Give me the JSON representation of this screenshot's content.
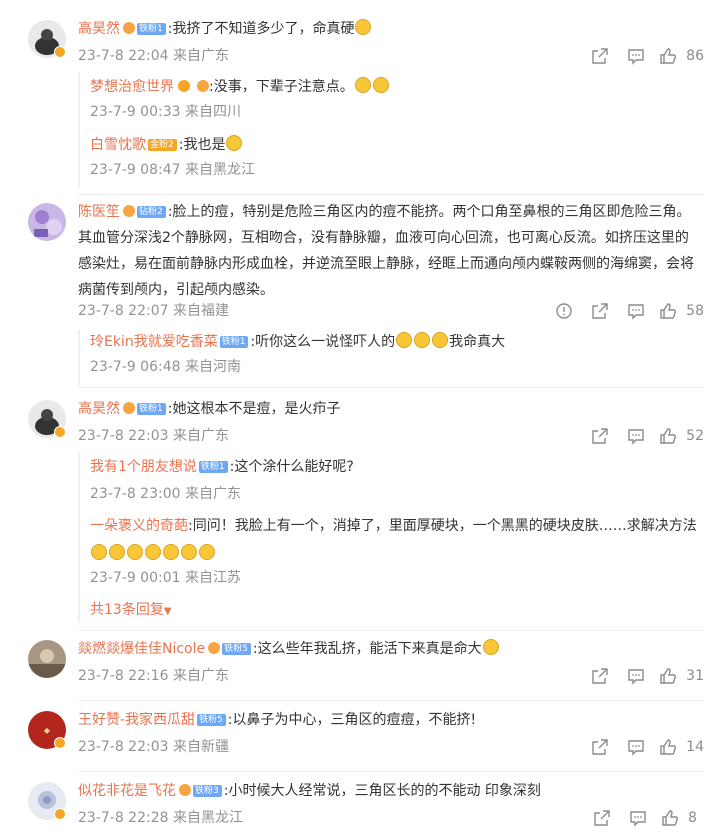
{
  "comments": [
    {
      "user": "高昊然",
      "fan_badge": "铁粉1",
      "text": ":我挤了不知道多少了，命真硬",
      "time": "23-7-8 22:04",
      "location": "来自广东",
      "likes": "86",
      "replies": [
        {
          "user": "梦想治愈世界",
          "text": ":没事，下辈子注意点。",
          "time": "23-7-9 00:33",
          "location": "来自四川"
        },
        {
          "user": "白雪忱歌",
          "fan_badge": "金粉2",
          "text": ":我也是",
          "time": "23-7-9 08:47",
          "location": "来自黑龙江"
        }
      ]
    },
    {
      "user": "陈医笙",
      "fan_badge": "钻粉2",
      "text": ":脸上的痘，特别是危险三角区内的痘不能挤。两个口角至鼻根的三角区即危险三角。其血管分深浅2个静脉网，互相吻合，没有静脉瓣，血液可向心回流，也可离心反流。如挤压这里的感染灶，易在面前静脉内形成血栓，并逆流至眼上静脉，经眶上而通向颅内蝶鞍两侧的海绵窦，会将病菌传到颅内，引起颅内感染。",
      "time": "23-7-8 22:07",
      "location": "来自福建",
      "likes": "58",
      "replies": [
        {
          "user": "玲Ekin我就爱吃香菜",
          "fan_badge": "铁粉1",
          "text": ":听你这么一说怪吓人的",
          "text2": "我命真大",
          "time": "23-7-9 06:48",
          "location": "来自河南"
        }
      ]
    },
    {
      "user": "高昊然",
      "fan_badge": "铁粉1",
      "text": ":她这根本不是痘，是火疖子",
      "time": "23-7-8 22:03",
      "location": "来自广东",
      "likes": "52",
      "replies": [
        {
          "user": "我有1个朋友想说",
          "fan_badge": "铁粉1",
          "text": ":这个涂什么能好呢?",
          "time": "23-7-8 23:00",
          "location": "来自广东"
        },
        {
          "user": "一朵褒义的奇葩",
          "text": ":同问！我脸上有一个，消掉了，里面厚硬块，一个黑黑的硬块皮肤……求解决方法",
          "time": "23-7-9 00:01",
          "location": "来自江苏"
        }
      ],
      "more": "共13条回复"
    },
    {
      "user": "燚燃燚爆佳佳Nicole",
      "fan_badge": "铁粉5",
      "text": ":这么些年我乱挤，能活下来真是命大",
      "time": "23-7-8 22:16",
      "location": "来自广东",
      "likes": "31"
    },
    {
      "user": "王好赞-我家西瓜甜",
      "fan_badge": "铁粉5",
      "text": ":以鼻子为中心，三角区的痘痘，不能挤!",
      "time": "23-7-8 22:03",
      "location": "来自新疆",
      "likes": "14"
    },
    {
      "user": "似花非花是飞花",
      "fan_badge": "铁粉3",
      "text": ":小时候大人经常说，三角区长的的不能动 印象深刻",
      "time": "23-7-8 22:28",
      "location": "来自黑龙江",
      "likes": "8"
    }
  ],
  "colors": {
    "username": "#eb7350",
    "meta": "#939393",
    "icon": "#8c8c8c"
  },
  "icons": [
    "share-icon",
    "comment-icon",
    "like-icon",
    "report-icon"
  ]
}
